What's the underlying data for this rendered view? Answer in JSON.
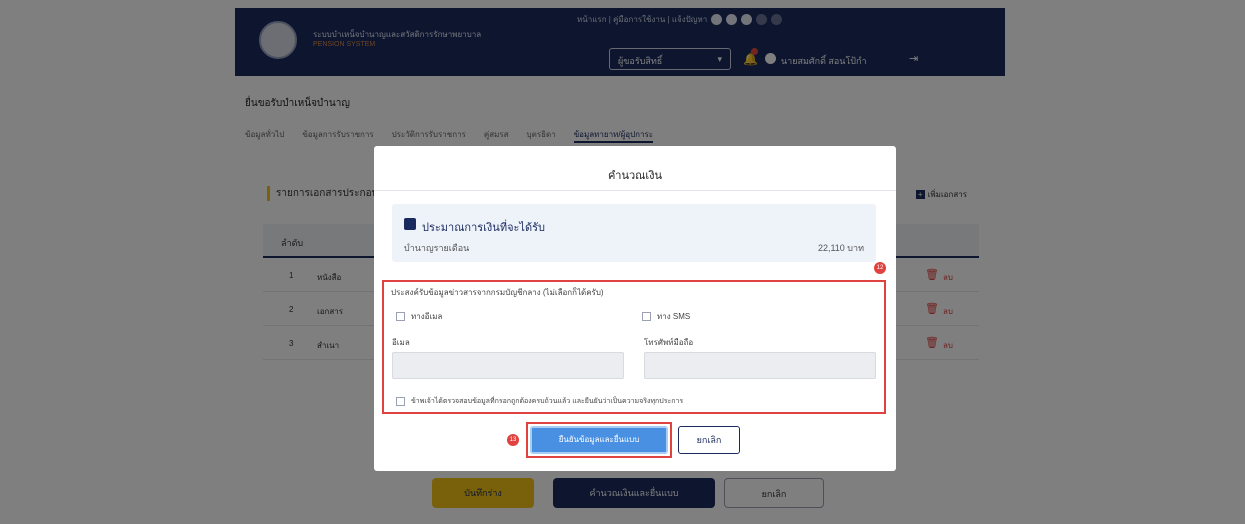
{
  "header": {
    "org_title": "ระบบบำเหน็จบำนาญและสวัสดิการรักษาพยาบาล",
    "org_subtitle": "PENSION SYSTEM",
    "top_links": "หน้าแรก | คู่มือการใช้งาน | แจ้งปัญหา",
    "role_select": "ผู้ขอรับสิทธิ์",
    "user_name": "นายสมศักดิ์ สอนโป้กำ"
  },
  "page": {
    "title": "ยื่นขอรับบำเหน็จบำนาญ",
    "tabs": [
      "ข้อมูลทั่วไป",
      "ข้อมูลการรับราชการ",
      "ประวัติการรับราชการ",
      "คู่สมรส",
      "บุตรธิดา",
      "ข้อมูลทายาท/ผู้อุปการะ"
    ],
    "card_title": "รายการเอกสารประกอบ",
    "add_label": "เพิ่มเอกสาร",
    "table_header": "ลำดับ",
    "rows": [
      {
        "no": "1",
        "name": "หนังสือ",
        "action": "ลบ"
      },
      {
        "no": "2",
        "name": "เอกสาร",
        "action": "ลบ"
      },
      {
        "no": "3",
        "name": "สำเนา",
        "action": "ลบ"
      }
    ],
    "btn_save": "บันทึกร่าง",
    "btn_calc": "คำนวณเงินและยื่นแบบ",
    "btn_cancel": "ยกเลิก"
  },
  "modal": {
    "title": "คำนวณเงิน",
    "info_heading": "ประมาณการเงินที่จะได้รับ",
    "info_label": "บำนาญรายเดือน",
    "info_value": "22,110 บาท",
    "consent_text": "ประสงค์รับข้อมูลข่าวสารจากกรมบัญชีกลาง (ไม่เลือกก็ได้ครับ)",
    "option_email": "ทางอีเมล",
    "option_sms": "ทาง SMS",
    "label_email": "อีเมล",
    "label_phone": "โทรศัพท์มือถือ",
    "email_value": "",
    "phone_value": "",
    "agree_text": "ข้าพเจ้าได้ตรวจสอบข้อมูลที่กรอกถูกต้องครบถ้วนแล้ว และยืนยันว่าเป็นความจริงทุกประการ",
    "btn_confirm": "ยืนยันข้อมูลและยื่นแบบ",
    "btn_cancel": "ยกเลิก",
    "step_badges": [
      "12",
      "13"
    ]
  }
}
